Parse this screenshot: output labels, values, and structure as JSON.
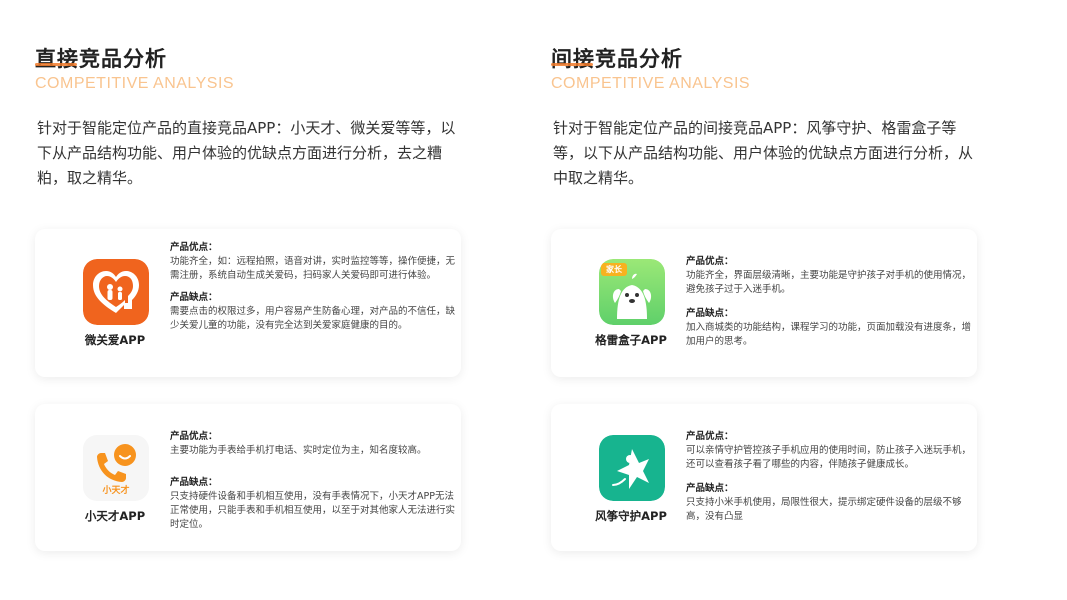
{
  "left": {
    "title": "直接竞品分析",
    "subtitle": "COMPETITIVE ANALYSIS",
    "intro": "针对于智能定位产品的直接竞品APP：小天才、微关爱等等，以下从产品结构功能、用户体验的优缺点方面进行分析，去之糟粕，取之精华。",
    "cards": [
      {
        "app_name": "微关爱APP",
        "icon": "family-heart-icon",
        "pros_label": "产品优点：",
        "pros": "功能齐全，如：远程拍照，语音对讲，实时监控等等，操作便捷，无需注册，系统自动生成关爱码，扫码家人关爱码即可进行体验。",
        "cons_label": "产品缺点：",
        "cons": "需要点击的权限过多，用户容易产生防备心理，对产品的不信任，缺少关爱儿童的功能，没有完全达到关爱家庭健康的目的。"
      },
      {
        "app_name": "小天才APP",
        "icon": "phone-smile-icon",
        "icon_text": "小天才",
        "pros_label": "产品优点：",
        "pros": "主要功能为手表给手机打电话、实时定位为主，知名度较高。",
        "cons_label": "产品缺点：",
        "cons": "只支持硬件设备和手机相互使用，没有手表情况下，小天才APP无法正常使用，只能手表和手机相互使用，以至于对其他家人无法进行实时定位。"
      }
    ]
  },
  "right": {
    "title": "间接竞品分析",
    "subtitle": "COMPETITIVE ANALYSIS",
    "intro": "针对于智能定位产品的间接竞品APP：风筝守护、格雷盒子等等，以下从产品结构功能、用户体验的优缺点方面进行分析，从中取之精华。",
    "cards": [
      {
        "app_name": "格雷盒子APP",
        "icon": "green-dog-icon",
        "icon_text": "家长",
        "pros_label": "产品优点：",
        "pros": "功能齐全，界面层级清晰，主要功能是守护孩子对手机的使用情况，避免孩子过于入迷手机。",
        "cons_label": "产品缺点：",
        "cons": "加入商城类的功能结构，课程学习的功能，页面加载没有进度条，增加用户的思考。"
      },
      {
        "app_name": "风筝守护APP",
        "icon": "kite-icon",
        "pros_label": "产品优点：",
        "pros": "可以亲情守护管控孩子手机应用的使用时间，防止孩子入迷玩手机，还可以查看孩子看了哪些的内容，伴随孩子健康成长。",
        "cons_label": "产品缺点：",
        "cons": "只支持小米手机使用，局限性很大，提示绑定硬件设备的层级不够高，没有凸显"
      }
    ]
  },
  "colors": {
    "accent": "#f07a2a",
    "subtitle": "#f9c48f",
    "orange_icon": "#f0641e",
    "green_icon": "#7ddc6a",
    "teal_icon": "#17b48f"
  }
}
